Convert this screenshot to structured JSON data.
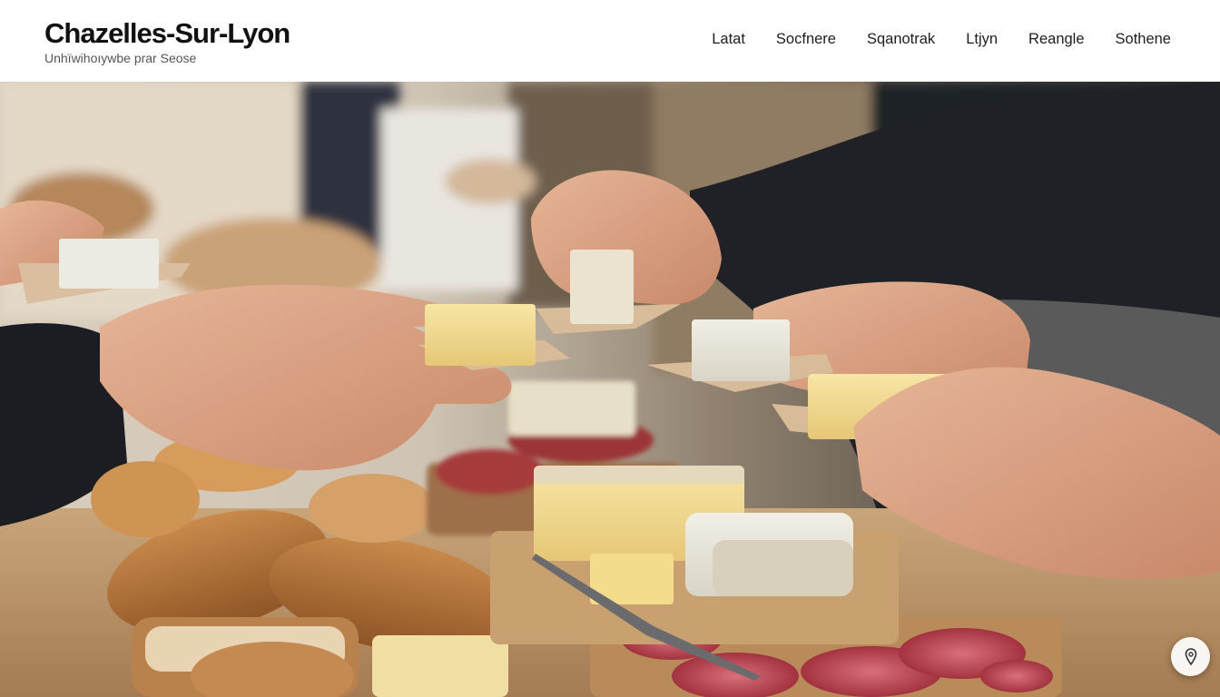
{
  "header": {
    "title": "Chazelles-Sur-Lyon",
    "tagline": "Unhïwihoıywbe prar Seose"
  },
  "nav": {
    "items": [
      {
        "label": "Latat"
      },
      {
        "label": "Socfnere"
      },
      {
        "label": "Sqanotrak"
      },
      {
        "label": "Ltjyn"
      },
      {
        "label": "Reangle"
      },
      {
        "label": "Sothene"
      }
    ]
  },
  "hero": {
    "subject": "hands sampling cheese at a market stall with bread, cheese and salami"
  },
  "fab": {
    "icon": "location-pin-icon"
  },
  "colors": {
    "header_bg": "#ffffff",
    "title": "#111111",
    "nav_text": "#1d1d1d"
  }
}
